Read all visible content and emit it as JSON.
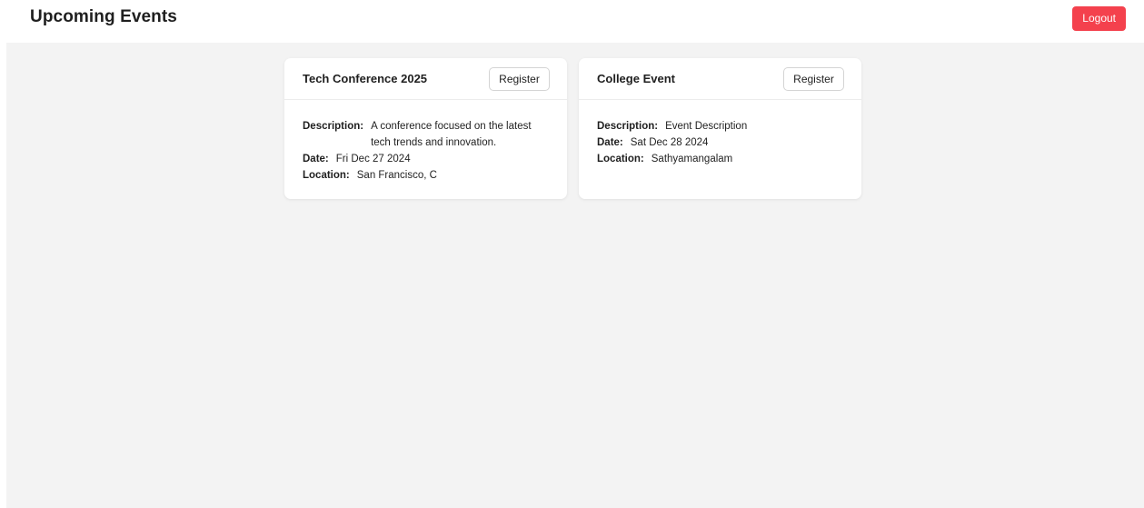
{
  "header": {
    "title": "Upcoming Events",
    "logout_label": "Logout"
  },
  "colors": {
    "logout_bg": "#f4414d",
    "main_bg": "#f3f3f3",
    "card_bg": "#ffffff"
  },
  "labels": {
    "description": "Description:",
    "date": "Date:",
    "location": "Location:"
  },
  "events": [
    {
      "title": "Tech Conference 2025",
      "register_label": "Register",
      "description": "A conference focused on the latest tech trends and innovation.",
      "date": "Fri Dec 27 2024",
      "location": "San Francisco, C"
    },
    {
      "title": "College Event",
      "register_label": "Register",
      "description": "Event Description",
      "date": "Sat Dec 28 2024",
      "location": "Sathyamangalam"
    }
  ]
}
